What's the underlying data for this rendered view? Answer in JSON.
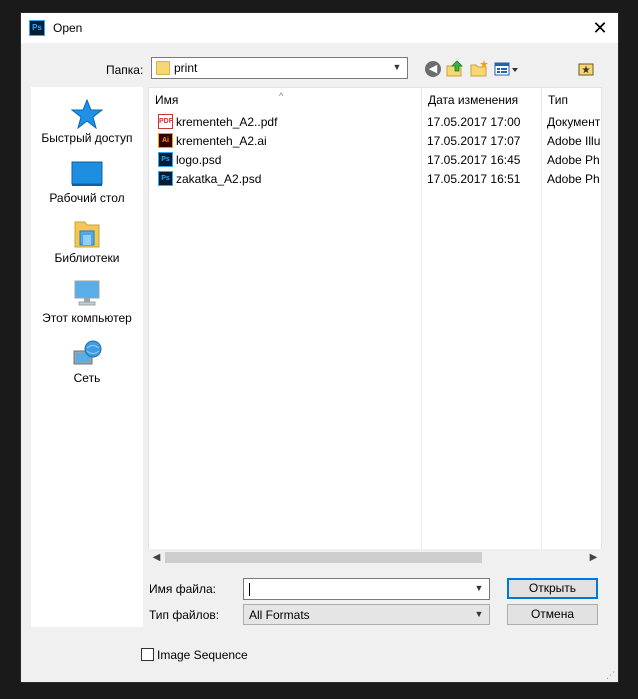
{
  "window": {
    "title": "Open",
    "app_icon": "Ps"
  },
  "toolbar": {
    "lookin_label": "Папка:",
    "lookin_value": "print",
    "icons": [
      "back-icon",
      "up-folder-icon",
      "new-folder-icon",
      "view-menu-icon",
      "desktop-shortcut-icon"
    ]
  },
  "places": [
    {
      "label": "Быстрый доступ",
      "icon": "star-icon"
    },
    {
      "label": "Рабочий стол",
      "icon": "desktop-icon"
    },
    {
      "label": "Библиотеки",
      "icon": "libraries-icon"
    },
    {
      "label": "Этот компьютер",
      "icon": "computer-icon"
    },
    {
      "label": "Сеть",
      "icon": "network-icon"
    }
  ],
  "filelist": {
    "columns": {
      "name": "Имя",
      "date": "Дата изменения",
      "type": "Тип"
    },
    "files": [
      {
        "icon_text": "PDF",
        "name": "krementeh_A2..pdf",
        "date": "17.05.2017 17:00",
        "type": "Документ"
      },
      {
        "icon_text": "Ai",
        "name": "krementeh_A2.ai",
        "date": "17.05.2017 17:07",
        "type": "Adobe Illu"
      },
      {
        "icon_text": "Ps",
        "name": "logo.psd",
        "date": "17.05.2017 16:45",
        "type": "Adobe Ph"
      },
      {
        "icon_text": "Ps",
        "name": "zakatka_A2.psd",
        "date": "17.05.2017 16:51",
        "type": "Adobe Ph"
      }
    ]
  },
  "form": {
    "filename_label": "Имя файла:",
    "filename_value": "",
    "filetype_label": "Тип файлов:",
    "filetype_value": "All Formats",
    "open_label": "Открыть",
    "cancel_label": "Отмена"
  },
  "image_sequence": {
    "label": "Image Sequence",
    "checked": false
  },
  "colors": {
    "accent": "#0078d7",
    "ps_blue": "#31a8ff",
    "folder": "#f7d774"
  }
}
